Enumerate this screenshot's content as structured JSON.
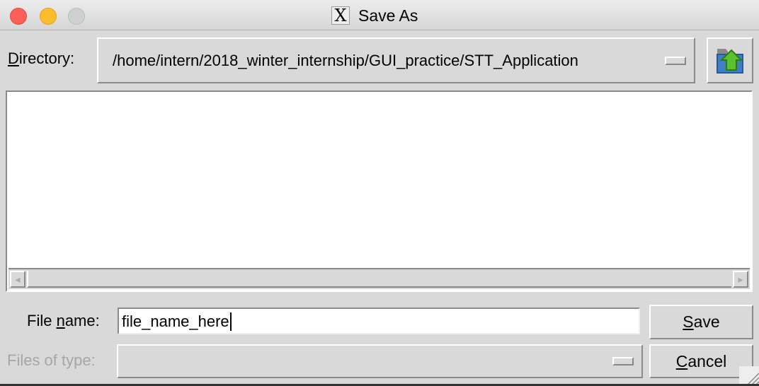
{
  "window": {
    "title": "Save As",
    "icon": "x-window-icon",
    "controls": {
      "close": "#fc5f57",
      "minimize": "#fdbc2e",
      "zoom": "#cfcfcf"
    }
  },
  "directory": {
    "label": {
      "pre": "",
      "key": "D",
      "post": "irectory:"
    },
    "value": "/home/intern/2018_winter_internship/GUI_practice/STT_Application",
    "up_icon": "folder-up-icon"
  },
  "file_list": {
    "items": []
  },
  "file_name": {
    "label": {
      "pre": "File ",
      "key": "n",
      "post": "ame:"
    },
    "value": "file_name_here"
  },
  "files_of_type": {
    "label": {
      "pre": "Files of ",
      "key": "t",
      "post": "ype:"
    },
    "value": "",
    "disabled": true
  },
  "buttons": {
    "save": {
      "pre": "",
      "key": "S",
      "post": "ave"
    },
    "cancel": {
      "pre": "",
      "key": "C",
      "post": "ancel"
    }
  }
}
